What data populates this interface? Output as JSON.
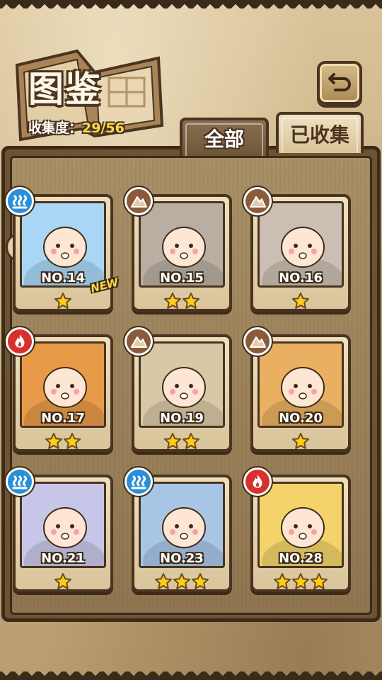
{
  "header": {
    "title": "图鉴",
    "progress_label": "收集度：",
    "progress_value": "29/56",
    "back_icon": "back-arrow-icon"
  },
  "tabs": [
    {
      "label": "全部",
      "active": false
    },
    {
      "label": "已收集",
      "active": true
    }
  ],
  "colors": {
    "water": "#2a8fd8",
    "earth": "#8a5a3a",
    "fire": "#d8302a",
    "star": "#ffcc1a"
  },
  "cards": [
    {
      "no": "NO.14",
      "element": "water",
      "stars": 1,
      "new": true,
      "new_label": "NEW",
      "bg": "#a9d6f5"
    },
    {
      "no": "NO.15",
      "element": "earth",
      "stars": 2,
      "new": false,
      "bg": "#b8afa2"
    },
    {
      "no": "NO.16",
      "element": "earth",
      "stars": 1,
      "new": false,
      "bg": "#cbbfb3"
    },
    {
      "no": "NO.17",
      "element": "fire",
      "stars": 2,
      "new": false,
      "bg": "#e79a48"
    },
    {
      "no": "NO.19",
      "element": "earth",
      "stars": 2,
      "new": false,
      "bg": "#d9c8a5"
    },
    {
      "no": "NO.20",
      "element": "earth",
      "stars": 1,
      "new": false,
      "bg": "#e8b060"
    },
    {
      "no": "NO.21",
      "element": "water",
      "stars": 1,
      "new": false,
      "bg": "#c8c6e8"
    },
    {
      "no": "NO.23",
      "element": "water",
      "stars": 3,
      "new": false,
      "bg": "#a7c6e6"
    },
    {
      "no": "NO.28",
      "element": "fire",
      "stars": 3,
      "new": false,
      "bg": "#f3d36a"
    }
  ]
}
